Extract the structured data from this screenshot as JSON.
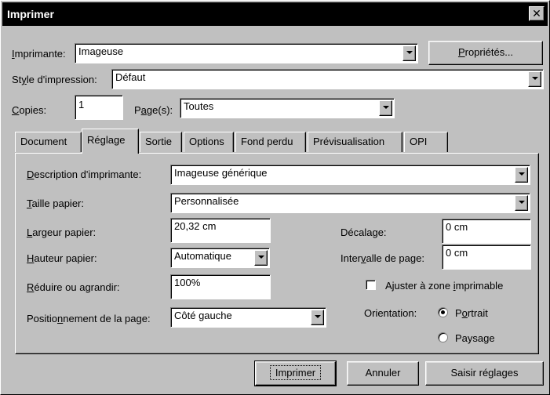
{
  "window": {
    "title": "Imprimer",
    "close_glyph": "✕"
  },
  "printer": {
    "label_pre": "",
    "label_u": "I",
    "label_post": "mprimante:",
    "value": "Imageuse",
    "properties_pre": "",
    "properties_u": "P",
    "properties_post": "ropriétés..."
  },
  "style": {
    "label_pre": "St",
    "label_u": "y",
    "label_post": "le d'impression:",
    "value": "Défaut"
  },
  "copies": {
    "label_pre": "",
    "label_u": "C",
    "label_post": "opies:",
    "value": "1"
  },
  "pages": {
    "label_pre": "P",
    "label_u": "a",
    "label_post": "ge(s):",
    "value": "Toutes"
  },
  "tabs": [
    {
      "label": "Document"
    },
    {
      "label": "Réglage"
    },
    {
      "label": "Sortie"
    },
    {
      "label": "Options"
    },
    {
      "label": "Fond perdu"
    },
    {
      "label": "Prévisualisation"
    },
    {
      "label": "OPI"
    }
  ],
  "settings": {
    "description": {
      "label_pre": "",
      "label_u": "D",
      "label_post": "escription d'imprimante:",
      "value": "Imageuse générique"
    },
    "paper_size": {
      "label_pre": "",
      "label_u": "T",
      "label_post": "aille papier:",
      "value": "Personnalisée"
    },
    "paper_width": {
      "label_pre": "",
      "label_u": "L",
      "label_post": "argeur papier:",
      "value": "20,32 cm"
    },
    "paper_height": {
      "label_pre": "",
      "label_u": "H",
      "label_post": "auteur papier:",
      "value": "Automatique"
    },
    "scale": {
      "label_pre": "",
      "label_u": "R",
      "label_post": "éduire ou agrandir:",
      "value": "100%"
    },
    "positioning": {
      "label_pre": "Positio",
      "label_u": "n",
      "label_post": "nement de la page:",
      "value": "Côté gauche"
    },
    "offset": {
      "label_pre": "Décala",
      "label_u": "g",
      "label_post": "e:",
      "value": "0 cm"
    },
    "page_gap": {
      "label_pre": "Inter",
      "label_u": "v",
      "label_post": "alle de page:",
      "value": "0 cm"
    },
    "fit": {
      "label_pre": "Ajuster à zone ",
      "label_u": "i",
      "label_post": "mprimable",
      "checked": false
    },
    "orientation": {
      "label": "Orientation:",
      "portrait_pre": "P",
      "portrait_u": "o",
      "portrait_post": "rtrait",
      "landscape_pre": "Paysa",
      "landscape_u": "g",
      "landscape_post": "e",
      "selected": "Portrait"
    }
  },
  "buttons": {
    "print": "Imprimer",
    "cancel": "Annuler",
    "capture": "Saisir réglages"
  }
}
